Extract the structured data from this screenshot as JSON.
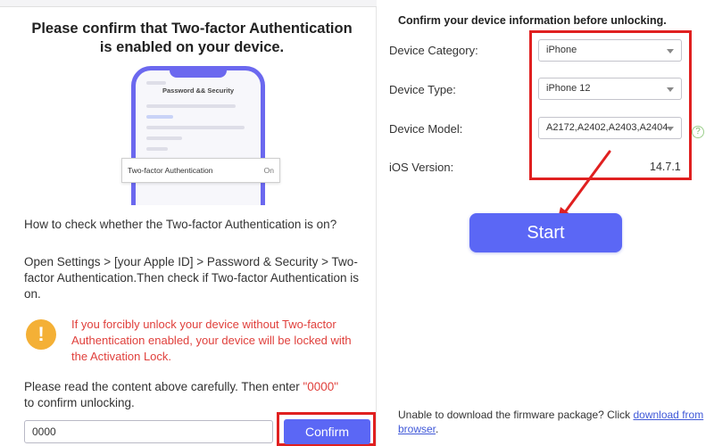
{
  "left": {
    "title": "Please confirm that Two-factor Authentication is enabled on your device.",
    "phone": {
      "screen_title": "Password && Security",
      "row_label": "Two-factor Authentication",
      "row_value": "On"
    },
    "howto_question": "How to check whether the Two-factor Authentication is on?",
    "howto_answer": "Open Settings > [your Apple ID] > Password & Security > Two-factor Authentication.Then check if Two-factor Authentication is on.",
    "warning_icon": "!",
    "warning_text": "If you forcibly unlock your device without Two-factor Authentication enabled, your device will be locked with the Activation Lock.",
    "confirm_instruction_part1": "Please read the content above carefully. Then enter ",
    "confirm_code": "\"0000\"",
    "confirm_instruction_part2": " to confirm unlocking.",
    "confirm_input_value": "0000",
    "confirm_button": "Confirm"
  },
  "right": {
    "title": "Confirm your device information before unlocking.",
    "fields": {
      "category_label": "Device Category:",
      "category_value": "iPhone",
      "type_label": "Device Type:",
      "type_value": "iPhone 12",
      "model_label": "Device Model:",
      "model_value": "A2172,A2402,A2403,A2404",
      "ios_label": "iOS Version:",
      "ios_value": "14.7.1"
    },
    "help_icon": "?",
    "start_button": "Start",
    "download_text": "Unable to download the firmware package? Click ",
    "download_link": "download from browser",
    "download_end": "."
  },
  "colors": {
    "accent": "#5b67f5",
    "highlight": "#e02020",
    "warning": "#e0403c",
    "warning_icon": "#f4b036",
    "phone_frame": "#6b68ef"
  }
}
